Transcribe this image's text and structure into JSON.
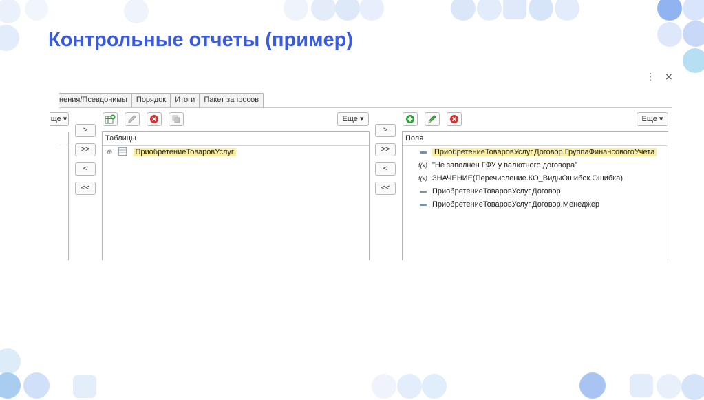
{
  "slide": {
    "title": "Контрольные отчеты (пример)"
  },
  "window": {
    "menu_icon": "⋮",
    "close_icon": "×"
  },
  "tabs": [
    {
      "label": "нения/Псевдонимы"
    },
    {
      "label": "Порядок"
    },
    {
      "label": "Итоги"
    },
    {
      "label": "Пакет запросов"
    }
  ],
  "left_stub": {
    "more_label": "ще"
  },
  "arrows": {
    "right": ">",
    "all_right": ">>",
    "left": "<",
    "all_left": "<<"
  },
  "tables_panel": {
    "header": "Таблицы",
    "more_label": "Еще",
    "items": [
      {
        "label": "ПриобретениеТоваровУслуг",
        "expand": "⊕"
      }
    ]
  },
  "fields_panel": {
    "header": "Поля",
    "more_label": "Еще",
    "items": [
      {
        "label": "ПриобретениеТоваровУслуг.Договор.ГруппаФинансовогоУчета",
        "icon": "field"
      },
      {
        "label": "\"Не заполнен ГФУ у валютного договора\"",
        "icon": "f(x)"
      },
      {
        "label": "ЗНАЧЕНИЕ(Перечисление.КО_ВидыОшибок.Ошибка)",
        "icon": "f(x)"
      },
      {
        "label": "ПриобретениеТоваровУслуг.Договор",
        "icon": "field"
      },
      {
        "label": "ПриобретениеТоваровУслуг.Договор.Менеджер",
        "icon": "field"
      }
    ]
  },
  "colors": {
    "title": "#3a5bd9",
    "highlight": "#faeea3",
    "add_green": "#2e9d3c",
    "delete_red": "#d8302f"
  }
}
